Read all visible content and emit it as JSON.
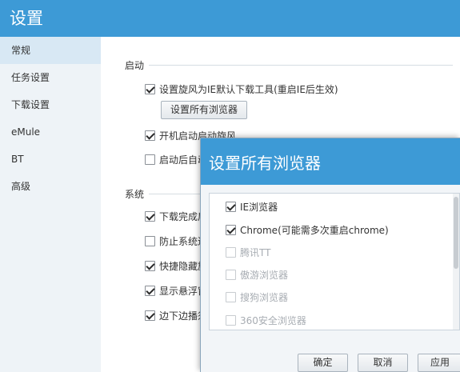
{
  "window": {
    "title": "设置"
  },
  "sidebar": {
    "items": [
      {
        "label": "常规"
      },
      {
        "label": "任务设置"
      },
      {
        "label": "下载设置"
      },
      {
        "label": "eMule"
      },
      {
        "label": "BT"
      },
      {
        "label": "高级"
      }
    ]
  },
  "startup": {
    "title": "启动",
    "set_default_label": "设置旋风为IE默认下载工具(重启IE后生效)",
    "set_all_browsers_button": "设置所有浏览器",
    "autostart_label": "开机启动启动旋风",
    "start_after_label": "启动后自动"
  },
  "system": {
    "title": "系统",
    "items": [
      {
        "label": "下载完成后"
      },
      {
        "label": "防止系统进"
      },
      {
        "label": "快捷隐藏旋"
      },
      {
        "label": "显示悬浮窗"
      },
      {
        "label": "边下边播须"
      }
    ]
  },
  "dialog": {
    "title": "设置所有浏览器",
    "browsers": [
      {
        "label": "IE浏览器",
        "checked": true,
        "enabled": true
      },
      {
        "label": "Chrome(可能需多次重启chrome)",
        "checked": true,
        "enabled": true
      },
      {
        "label": "腾讯TT",
        "checked": false,
        "enabled": false
      },
      {
        "label": "傲游浏览器",
        "checked": false,
        "enabled": false
      },
      {
        "label": "搜狗浏览器",
        "checked": false,
        "enabled": false
      },
      {
        "label": "360安全浏览器",
        "checked": false,
        "enabled": false
      }
    ],
    "ok_button": "确定",
    "cancel_button": "取消",
    "apply_button": "应用"
  }
}
